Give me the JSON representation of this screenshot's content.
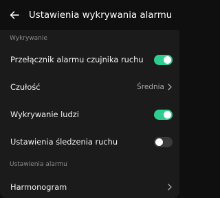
{
  "header": {
    "title": "Ustawienia wykrywania alarmu"
  },
  "sections": {
    "detection": "Wykrywanie",
    "alarm": "Ustawienia alarmu"
  },
  "rows": {
    "motion_alarm": {
      "label": "Przełącznik alarmu czujnika ruchu",
      "enabled": true
    },
    "sensitivity": {
      "label": "Czułość",
      "value": "Średnia"
    },
    "human_detection": {
      "label": "Wykrywanie ludzi",
      "enabled": true
    },
    "motion_tracking": {
      "label": "Ustawienia śledzenia ruchu",
      "enabled": false
    },
    "schedule": {
      "label": "Harmonogram"
    }
  },
  "colors": {
    "accent": "#2ecc8f",
    "background": "#0f0f0f",
    "panel": "#1b1b1b"
  }
}
